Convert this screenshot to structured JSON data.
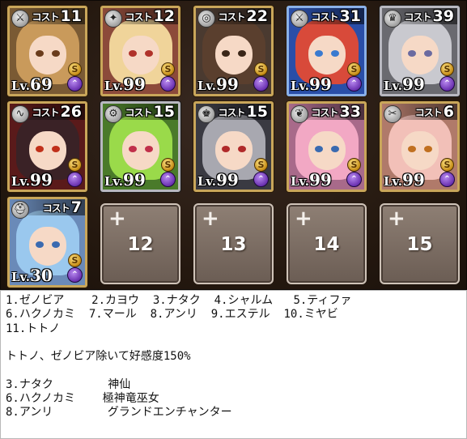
{
  "units": [
    {
      "cost_label": "コスト",
      "cost": "11",
      "lv_prefix": "Lv.",
      "level": "69",
      "s_badge": "S",
      "up_badge": "⌃",
      "class_icon": "dagger-icon",
      "colors": {
        "bg": "#7a5a34",
        "hair": "#c99a5b",
        "eye": "#6a3c1c"
      }
    },
    {
      "cost_label": "コスト",
      "cost": "12",
      "lv_prefix": "Lv.",
      "level": "99",
      "s_badge": "S",
      "up_badge": "⌃",
      "class_icon": "feather-icon",
      "colors": {
        "bg": "#8c4a3a",
        "hair": "#f0d49a",
        "eye": "#b0322a"
      }
    },
    {
      "cost_label": "コスト",
      "cost": "22",
      "lv_prefix": "Lv.",
      "level": "99",
      "s_badge": "S",
      "up_badge": "⌃",
      "class_icon": "orb-icon",
      "colors": {
        "bg": "#4a3a30",
        "hair": "#5a3f2e",
        "eye": "#3a2618"
      }
    },
    {
      "cost_label": "コスト",
      "cost": "31",
      "lv_prefix": "Lv.",
      "level": "99",
      "s_badge": "S",
      "up_badge": "⌃",
      "class_icon": "sword-icon",
      "colors": {
        "bg": "#2a4ea8",
        "hair": "#d84a3a",
        "eye": "#3a7ad0"
      }
    },
    {
      "cost_label": "コスト",
      "cost": "39",
      "lv_prefix": "Lv.",
      "level": "99",
      "s_badge": "S",
      "up_badge": "⌃",
      "class_icon": "dragon-icon",
      "colors": {
        "bg": "#6a6a70",
        "hair": "#c9c9cf",
        "eye": "#6a6aa0"
      }
    },
    {
      "cost_label": "コスト",
      "cost": "26",
      "lv_prefix": "Lv.",
      "level": "99",
      "s_badge": "S",
      "up_badge": "⌃",
      "class_icon": "whip-icon",
      "colors": {
        "bg": "#5a1a1a",
        "hair": "#3a2226",
        "eye": "#c0301a"
      }
    },
    {
      "cost_label": "コスト",
      "cost": "15",
      "lv_prefix": "Lv.",
      "level": "99",
      "s_badge": "S",
      "up_badge": "⌃",
      "class_icon": "gear-icon",
      "colors": {
        "bg": "#4a7a2a",
        "hair": "#9ada4a",
        "eye": "#c0304a"
      }
    },
    {
      "cost_label": "コスト",
      "cost": "15",
      "lv_prefix": "Lv.",
      "level": "99",
      "s_badge": "S",
      "up_badge": "⌃",
      "class_icon": "crown-icon",
      "colors": {
        "bg": "#3a3a42",
        "hair": "#a8a8b0",
        "eye": "#b02a2a"
      }
    },
    {
      "cost_label": "コスト",
      "cost": "33",
      "lv_prefix": "Lv.",
      "level": "99",
      "s_badge": "S",
      "up_badge": "⌃",
      "class_icon": "wing-icon",
      "colors": {
        "bg": "#a86a8a",
        "hair": "#f2a8c4",
        "eye": "#3a6ab0"
      }
    },
    {
      "cost_label": "コスト",
      "cost": "6",
      "lv_prefix": "Lv.",
      "level": "99",
      "s_badge": "S",
      "up_badge": "⌃",
      "class_icon": "scissors-icon",
      "colors": {
        "bg": "#b07a6a",
        "hair": "#f2c0b8",
        "eye": "#c07020"
      }
    },
    {
      "cost_label": "コスト",
      "cost": "7",
      "lv_prefix": "Lv.",
      "level": "30",
      "s_badge": "S",
      "up_badge": "⌃",
      "class_icon": "helmet-icon",
      "colors": {
        "bg": "#6a8ab8",
        "hair": "#9ac8ee",
        "eye": "#3a6ab0"
      }
    }
  ],
  "empty_slots": [
    {
      "plus": "+",
      "number": "12"
    },
    {
      "plus": "+",
      "number": "13"
    },
    {
      "plus": "+",
      "number": "14"
    },
    {
      "plus": "+",
      "number": "15"
    }
  ],
  "notes": {
    "lines": [
      "1.ゼノビア    2.カヨウ  3.ナタク  4.シャルム   5.ティファ",
      "6.ハクノカミ  7.マール  8.アンリ  9.エステル  10.ミヤビ",
      "11.トトノ",
      "",
      "トトノ、ゼノビア除いて好感度150%",
      "",
      "3.ナタク        神仙",
      "6.ハクノカミ    極神竜巫女",
      "8.アンリ        グランドエンチャンター"
    ]
  }
}
